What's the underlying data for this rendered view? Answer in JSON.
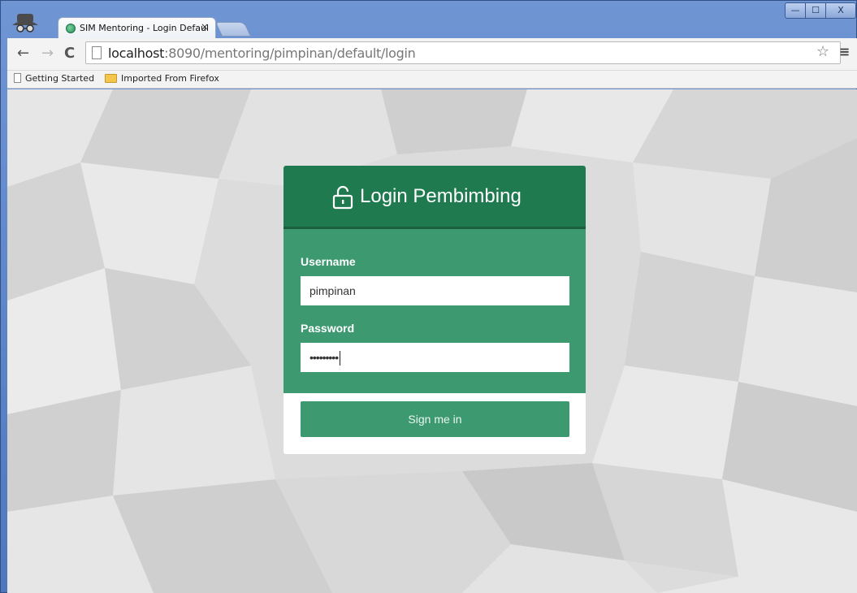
{
  "browser": {
    "tab_title": "SIM Mentoring - Login Defaul",
    "tab_close": "×",
    "url_host": "localhost",
    "url_rest": ":8090/mentoring/pimpinan/default/login",
    "window_controls": {
      "minimize": "—",
      "maximize": "☐",
      "close": "X"
    },
    "nav": {
      "back": "←",
      "forward": "→",
      "reload": "C"
    },
    "star": "☆",
    "menu": "≡"
  },
  "bookmarks": [
    {
      "label": "Getting Started",
      "icon": "page-icon"
    },
    {
      "label": "Imported From Firefox",
      "icon": "folder-icon"
    }
  ],
  "login": {
    "title": "Login Pembimbing",
    "username_label": "Username",
    "username_value": "pimpinan",
    "password_label": "Password",
    "password_value": "•••••••••",
    "submit_label": "Sign me in"
  },
  "colors": {
    "header": "#1f7a4f",
    "body": "#3d9970",
    "button": "#3d9970"
  }
}
